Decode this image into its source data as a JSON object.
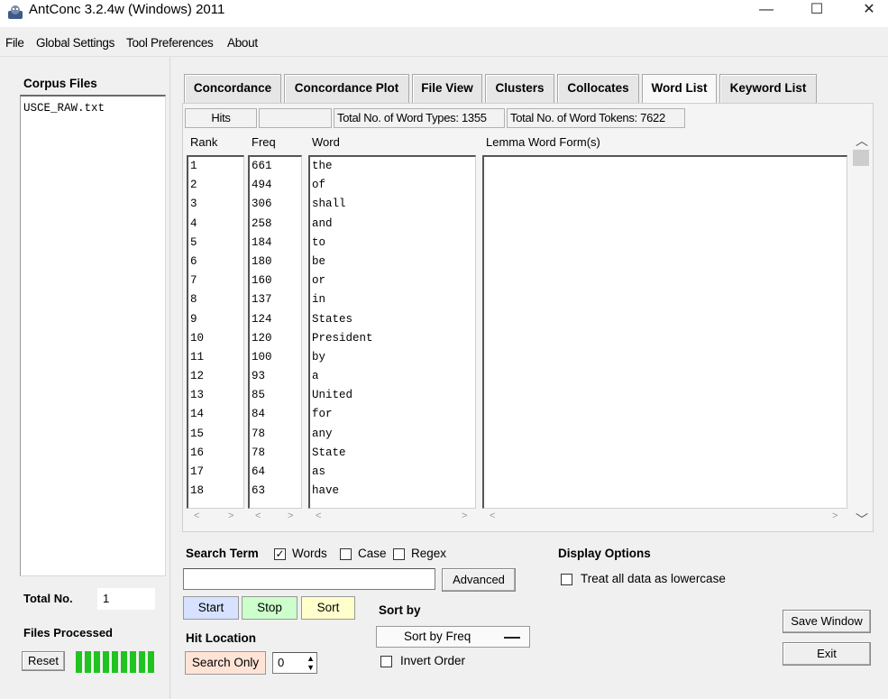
{
  "window": {
    "title": "AntConc 3.2.4w (Windows) 2011",
    "minimize": "—",
    "maximize": "☐",
    "close": "✕"
  },
  "menu": [
    "File",
    "Global Settings",
    "Tool Preferences",
    "About"
  ],
  "left_panel": {
    "corpus_label": "Corpus Files",
    "files": [
      "USCE_RAW.txt"
    ],
    "total_label": "Total No.",
    "total_value": "1",
    "processed_label": "Files Processed",
    "reset_label": "Reset",
    "progress_fraction": 1.0
  },
  "tabs": [
    {
      "label": "Concordance",
      "active": false
    },
    {
      "label": "Concordance Plot",
      "active": false
    },
    {
      "label": "File View",
      "active": false
    },
    {
      "label": "Clusters",
      "active": false
    },
    {
      "label": "Collocates",
      "active": false
    },
    {
      "label": "Word List",
      "active": true
    },
    {
      "label": "Keyword List",
      "active": false
    }
  ],
  "info": {
    "hits": "Hits",
    "hits_value": "",
    "word_types": "Total No. of Word Types: 1355",
    "word_tokens": "Total No. of Word Tokens: 7622"
  },
  "columns": {
    "rank": "Rank",
    "freq": "Freq",
    "word": "Word",
    "lemma": "Lemma Word Form(s)"
  },
  "rows": [
    {
      "rank": "1",
      "freq": "661",
      "word": "the"
    },
    {
      "rank": "2",
      "freq": "494",
      "word": "of"
    },
    {
      "rank": "3",
      "freq": "306",
      "word": "shall"
    },
    {
      "rank": "4",
      "freq": "258",
      "word": "and"
    },
    {
      "rank": "5",
      "freq": "184",
      "word": "to"
    },
    {
      "rank": "6",
      "freq": "180",
      "word": "be"
    },
    {
      "rank": "7",
      "freq": "160",
      "word": "or"
    },
    {
      "rank": "8",
      "freq": "137",
      "word": "in"
    },
    {
      "rank": "9",
      "freq": "124",
      "word": "States"
    },
    {
      "rank": "10",
      "freq": "120",
      "word": "President"
    },
    {
      "rank": "11",
      "freq": "100",
      "word": "by"
    },
    {
      "rank": "12",
      "freq": "93",
      "word": "a"
    },
    {
      "rank": "13",
      "freq": "85",
      "word": "United"
    },
    {
      "rank": "14",
      "freq": "84",
      "word": "for"
    },
    {
      "rank": "15",
      "freq": "78",
      "word": "any"
    },
    {
      "rank": "16",
      "freq": "78",
      "word": "State"
    },
    {
      "rank": "17",
      "freq": "64",
      "word": "as"
    },
    {
      "rank": "18",
      "freq": "63",
      "word": "have"
    }
  ],
  "search": {
    "label": "Search Term",
    "words_label": "Words",
    "words_checked": true,
    "case_label": "Case",
    "case_checked": false,
    "regex_label": "Regex",
    "regex_checked": false,
    "term_value": "",
    "advanced_label": "Advanced",
    "start_label": "Start",
    "stop_label": "Stop",
    "sort_label": "Sort"
  },
  "hit_location": {
    "label": "Hit Location",
    "search_only_label": "Search Only",
    "value": "0"
  },
  "sort_by": {
    "label": "Sort by",
    "selected": "Sort by Freq",
    "invert_label": "Invert Order",
    "invert_checked": false
  },
  "display_options": {
    "label": "Display Options",
    "lowercase_label": "Treat all data as lowercase",
    "lowercase_checked": false
  },
  "buttons": {
    "save_window": "Save Window",
    "exit": "Exit"
  },
  "colors": {
    "start_bg": "#d6e2ff",
    "stop_bg": "#ccffcc",
    "sort_bg": "#ffffcc",
    "search_only_bg": "#ffe4d6",
    "progress": "#21c321"
  }
}
